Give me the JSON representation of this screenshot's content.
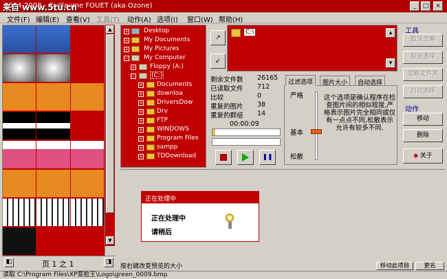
{
  "window": {
    "title": "2004-2008 - Guillaume FOUET (aka Ozone)",
    "watermark": "来自 www.5tu.cn",
    "controls": [
      "_",
      "□",
      "×"
    ]
  },
  "menu": [
    "文件(F)",
    "编辑(E)",
    "查看(V)",
    "工具(T)",
    "动作(A)",
    "选项(I)",
    "窗口(W)",
    "帮助(H)"
  ],
  "pager": {
    "label": "页 1 之 1"
  },
  "tree": {
    "items": [
      "Desktop",
      "My Documents",
      "My Pictures",
      "My Computer",
      "Floppy (A:)",
      "(C:)",
      "Documents",
      "downloa",
      "DriversDow",
      "Drv",
      "FTP",
      "WINDOWS",
      "Program Files",
      "sampp",
      "TDDownload"
    ]
  },
  "folder": {
    "path": "C:\\"
  },
  "stats": {
    "rows": [
      {
        "label": "剩余文件数",
        "value": "26165"
      },
      {
        "label": "已读取文件",
        "value": "712"
      },
      {
        "label": "比较",
        "value": "0"
      },
      {
        "label": "重复的图片",
        "value": "38"
      },
      {
        "label": "重复的群组",
        "value": "14"
      }
    ],
    "time": "00:00:09",
    "progress": 0.04
  },
  "tabs": {
    "labels": [
      "过滤选项",
      "图片大小",
      "自动选择"
    ],
    "slider": {
      "strict": "严格",
      "basic": "基本",
      "loose": "松散",
      "level": 0.55
    },
    "description": "这个选项是确认程序在检查图片间的相似程度,严格表示图片完全相同或仅有一点点不同,松散表示允许有较多不同."
  },
  "tools": {
    "title": "工具",
    "buttons": [
      "取消忽略",
      "取消选择",
      "忽略文件夹",
      "自动选择"
    ]
  },
  "actions": {
    "title": "动作",
    "buttons": [
      "移动",
      "删除"
    ],
    "about": "关于"
  },
  "dialog": {
    "title": "正在处理中",
    "line1": "正在处理中",
    "line2": "请稍后"
  },
  "hint": "按右键改变预览的大小",
  "bottom_buttons": [
    "移动此项目",
    "更名"
  ],
  "status": "读取 C:\\Program Files\\XP变脸王\\Logo\\green_0009.bmp",
  "colors": {
    "accent": "#c00000",
    "panel": "#d4d0c8"
  }
}
